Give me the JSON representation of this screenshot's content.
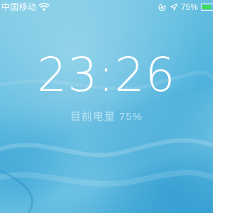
{
  "status_bar": {
    "carrier": "中国移动",
    "battery_percent": "75%",
    "battery_level": 0.75,
    "icons": [
      "wifi-icon",
      "rotation-lock-icon",
      "location-arrow-icon",
      "battery-icon"
    ]
  },
  "lockscreen": {
    "time": "23:26",
    "charge_status": "目前电量 75%"
  },
  "colors": {
    "battery_fill": "#3ddc55",
    "wallpaper_base": "#5bb9df"
  }
}
